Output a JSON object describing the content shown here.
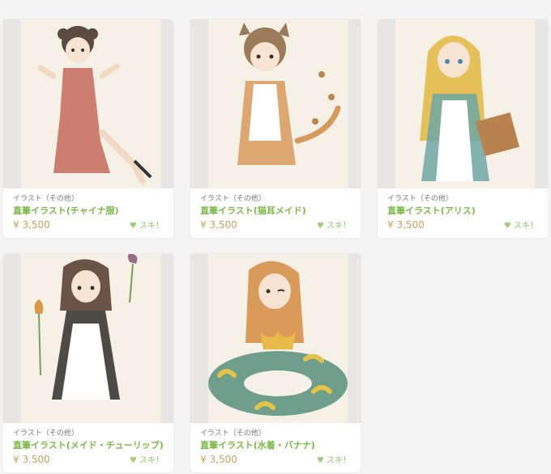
{
  "products": [
    {
      "category": "イラスト（その他）",
      "title": "直筆イラスト(チャイナ服)",
      "price": "¥ 3,500",
      "like_label": "スキ！",
      "illustration": "china-dress-girl"
    },
    {
      "category": "イラスト（その他）",
      "title": "直筆イラスト(猫耳メイド)",
      "price": "¥ 3,500",
      "like_label": "スキ！",
      "illustration": "cat-ear-maid"
    },
    {
      "category": "イラスト（その他）",
      "title": "直筆イラスト(アリス)",
      "price": "¥ 3,500",
      "like_label": "スキ！",
      "illustration": "alice"
    },
    {
      "category": "イラスト（その他）",
      "title": "直筆イラスト(メイド・チューリップ)",
      "price": "¥ 3,500",
      "like_label": "スキ！",
      "illustration": "maid-tulip"
    },
    {
      "category": "イラスト（その他）",
      "title": "直筆イラスト(水着・バナナ)",
      "price": "¥ 3,500",
      "like_label": "スキ！",
      "illustration": "swimsuit-banana"
    }
  ],
  "colors": {
    "title": "#7ab846",
    "price": "#c9a25c",
    "like": "#8fc468"
  }
}
